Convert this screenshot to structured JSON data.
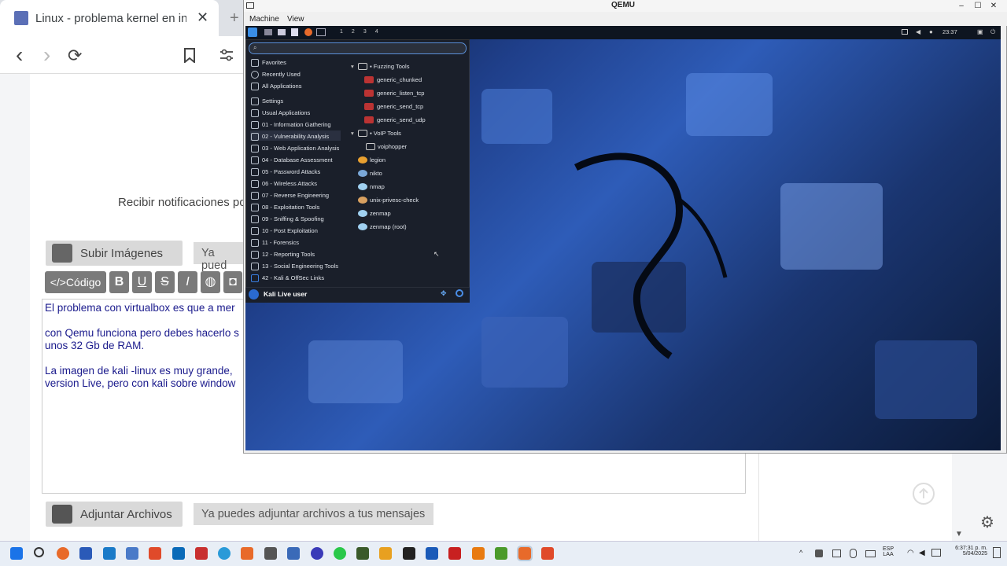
{
  "browser": {
    "tab_title": "Linux - problema kernel en inst",
    "close_tab": "✕",
    "new_tab": "+",
    "nav": {
      "back": "‹",
      "forward": "›",
      "reload": "⟳"
    }
  },
  "page": {
    "notif_text": "Recibir notificaciones po",
    "upload_images": "Subir Imágenes",
    "upload_images_tag": "Ya pued",
    "code_btn": "</>Código",
    "bold_btn": "B",
    "underline_btn": "U",
    "strike_btn": "S",
    "italic_btn": "I",
    "editor_lines": [
      "El problema con virtualbox es que a mer",
      "con Qemu funciona pero debes hacerlo s",
      "unos 32 Gb de RAM.",
      "La imagen de kali -linux es muy grande,",
      "version Live, pero con kali sobre window"
    ],
    "attach_files": "Adjuntar Archivos",
    "attach_tag": "Ya puedes adjuntar archivos a tus mensajes"
  },
  "qemu": {
    "title": "QEMU",
    "menu": [
      "Machine",
      "View"
    ],
    "window_buttons": [
      "–",
      "☐",
      "✕"
    ]
  },
  "kali": {
    "workspaces": [
      "1",
      "2",
      "3",
      "4"
    ],
    "clock": "23:37",
    "categories": [
      "Favorites",
      "Recently Used",
      "All Applications",
      "Settings",
      "Usual Applications",
      "01 - Information Gathering",
      "02 - Vulnerability Analysis",
      "03 - Web Application Analysis",
      "04 - Database Assessment",
      "05 - Password Attacks",
      "06 - Wireless Attacks",
      "07 - Reverse Engineering",
      "08 - Exploitation Tools",
      "09 - Sniffing & Spoofing",
      "10 - Post Exploitation",
      "11 - Forensics",
      "12 - Reporting Tools",
      "13 - Social Engineering Tools",
      "42 - Kali & OffSec Links"
    ],
    "fuzz_header": "Fuzzing Tools",
    "fuzz_apps": [
      "generic_chunked",
      "generic_listen_tcp",
      "generic_send_tcp",
      "generic_send_udp"
    ],
    "voip_header": "VoIP Tools",
    "voip_apps": [
      "voiphopper"
    ],
    "apps": [
      "legion",
      "nikto",
      "nmap",
      "unix-privesc-check",
      "zenmap",
      "zenmap (root)"
    ],
    "user": "Kali Live user"
  },
  "taskbar": {
    "lang": [
      "ESP",
      "LAA"
    ],
    "time": "6:37:31 p. m.",
    "date": "5/04/2025"
  }
}
